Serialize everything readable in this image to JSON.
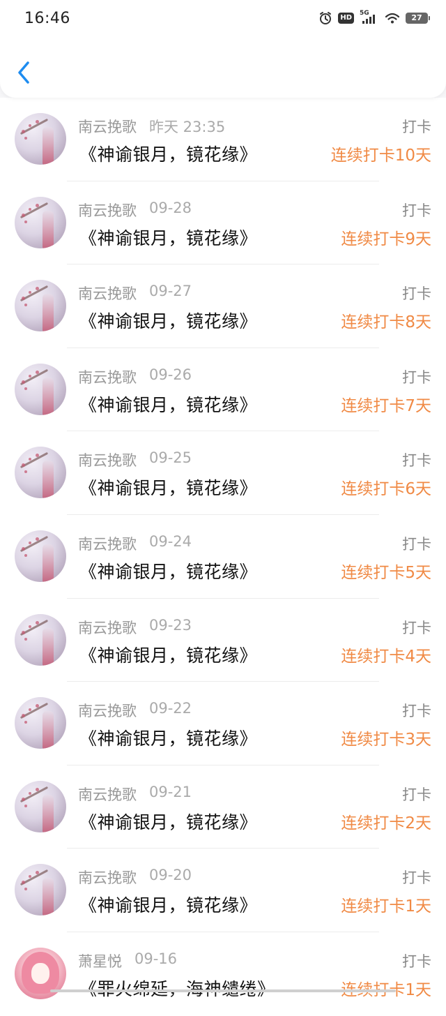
{
  "status_bar": {
    "time": "16:46",
    "network_label": "5G",
    "hd_label": "HD",
    "battery_level": "27",
    "icons": [
      "alarm-icon",
      "hd-icon",
      "signal-5g-icon",
      "wifi-icon",
      "battery-icon"
    ]
  },
  "header": {
    "back_icon": "chevron-left-icon"
  },
  "colors": {
    "accent": "#1d8cf0",
    "streak": "#f08a45",
    "name": "#999999",
    "title": "#111111"
  },
  "items": [
    {
      "author": "南云挽歌",
      "date": "昨天 23:35",
      "title": "《神谕银月，镜花缘》",
      "type": "打卡",
      "streak": "连续打卡10天"
    },
    {
      "author": "南云挽歌",
      "date": "09-28",
      "title": "《神谕银月，镜花缘》",
      "type": "打卡",
      "streak": "连续打卡9天"
    },
    {
      "author": "南云挽歌",
      "date": "09-27",
      "title": "《神谕银月，镜花缘》",
      "type": "打卡",
      "streak": "连续打卡8天"
    },
    {
      "author": "南云挽歌",
      "date": "09-26",
      "title": "《神谕银月，镜花缘》",
      "type": "打卡",
      "streak": "连续打卡7天"
    },
    {
      "author": "南云挽歌",
      "date": "09-25",
      "title": "《神谕银月，镜花缘》",
      "type": "打卡",
      "streak": "连续打卡6天"
    },
    {
      "author": "南云挽歌",
      "date": "09-24",
      "title": "《神谕银月，镜花缘》",
      "type": "打卡",
      "streak": "连续打卡5天"
    },
    {
      "author": "南云挽歌",
      "date": "09-23",
      "title": "《神谕银月，镜花缘》",
      "type": "打卡",
      "streak": "连续打卡4天"
    },
    {
      "author": "南云挽歌",
      "date": "09-22",
      "title": "《神谕银月，镜花缘》",
      "type": "打卡",
      "streak": "连续打卡3天"
    },
    {
      "author": "南云挽歌",
      "date": "09-21",
      "title": "《神谕银月，镜花缘》",
      "type": "打卡",
      "streak": "连续打卡2天"
    },
    {
      "author": "南云挽歌",
      "date": "09-20",
      "title": "《神谕银月，镜花缘》",
      "type": "打卡",
      "streak": "连续打卡1天"
    },
    {
      "author": "萧星悦",
      "date": "09-16",
      "title": "《罪火绵延，海神缱绻》",
      "type": "打卡",
      "streak": "连续打卡1天"
    }
  ]
}
